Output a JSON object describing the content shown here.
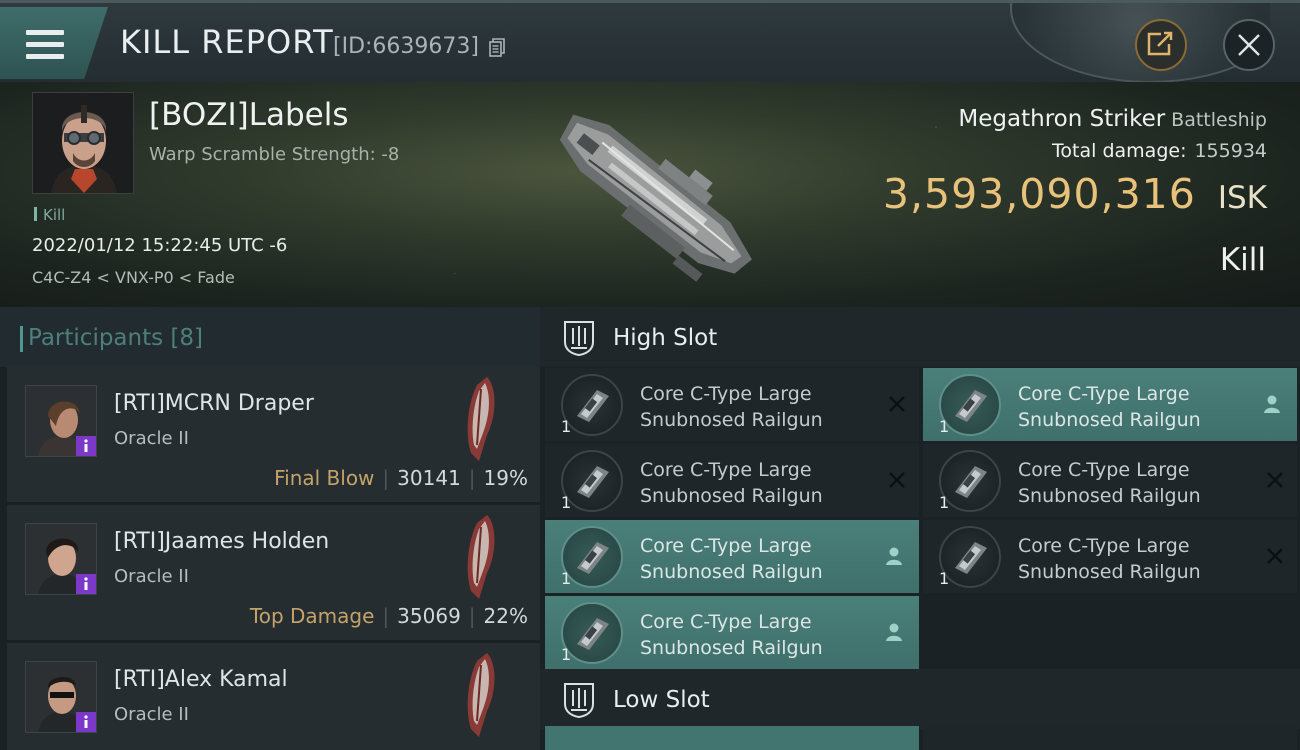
{
  "header": {
    "title": "KILL REPORT",
    "report_id": "[ID:6639673]"
  },
  "victim": {
    "name": "[BOZI]Labels",
    "warp_scramble": "Warp Scramble Strength: -8",
    "kill_label": "Kill",
    "timestamp": "2022/01/12 15:22:45 UTC -6",
    "location": "C4C-Z4 < VNX-P0 < Fade"
  },
  "ship": {
    "name": "Megathron Striker",
    "class": "Battleship",
    "total_damage_label": "Total damage:",
    "total_damage": "155934",
    "value": "3,593,090,316",
    "currency": "ISK",
    "result": "Kill"
  },
  "participants": {
    "title": "Participants",
    "count": "[8]",
    "rows": [
      {
        "name": "[RTI]MCRN Draper",
        "ship": "Oracle II",
        "tag": "Final Blow",
        "damage": "30141",
        "percent": "19%"
      },
      {
        "name": "[RTI]Jaames Holden",
        "ship": "Oracle II",
        "tag": "Top Damage",
        "damage": "35069",
        "percent": "22%"
      },
      {
        "name": "[RTI]Alex Kamal",
        "ship": "Oracle II",
        "tag": "",
        "damage": "",
        "percent": ""
      }
    ]
  },
  "high_slot": {
    "title": "High Slot",
    "modules": [
      {
        "name": "Core C-Type Large Snubnosed Railgun",
        "qty": "1",
        "status": "dropped"
      },
      {
        "name": "Core C-Type Large Snubnosed Railgun",
        "qty": "1",
        "status": "looted"
      },
      {
        "name": "Core C-Type Large Snubnosed Railgun",
        "qty": "1",
        "status": "dropped"
      },
      {
        "name": "Core C-Type Large Snubnosed Railgun",
        "qty": "1",
        "status": "dropped"
      },
      {
        "name": "Core C-Type Large Snubnosed Railgun",
        "qty": "1",
        "status": "looted"
      },
      {
        "name": "Core C-Type Large Snubnosed Railgun",
        "qty": "1",
        "status": "dropped"
      },
      {
        "name": "Core C-Type Large Snubnosed Railgun",
        "qty": "1",
        "status": "looted"
      }
    ]
  },
  "low_slot": {
    "title": "Low Slot"
  },
  "colors": {
    "accent_teal": "#4b7f7a",
    "isk_gold": "#e8c27a",
    "tag_gold": "#c4a36a",
    "role_purple": "#7b38c9"
  }
}
